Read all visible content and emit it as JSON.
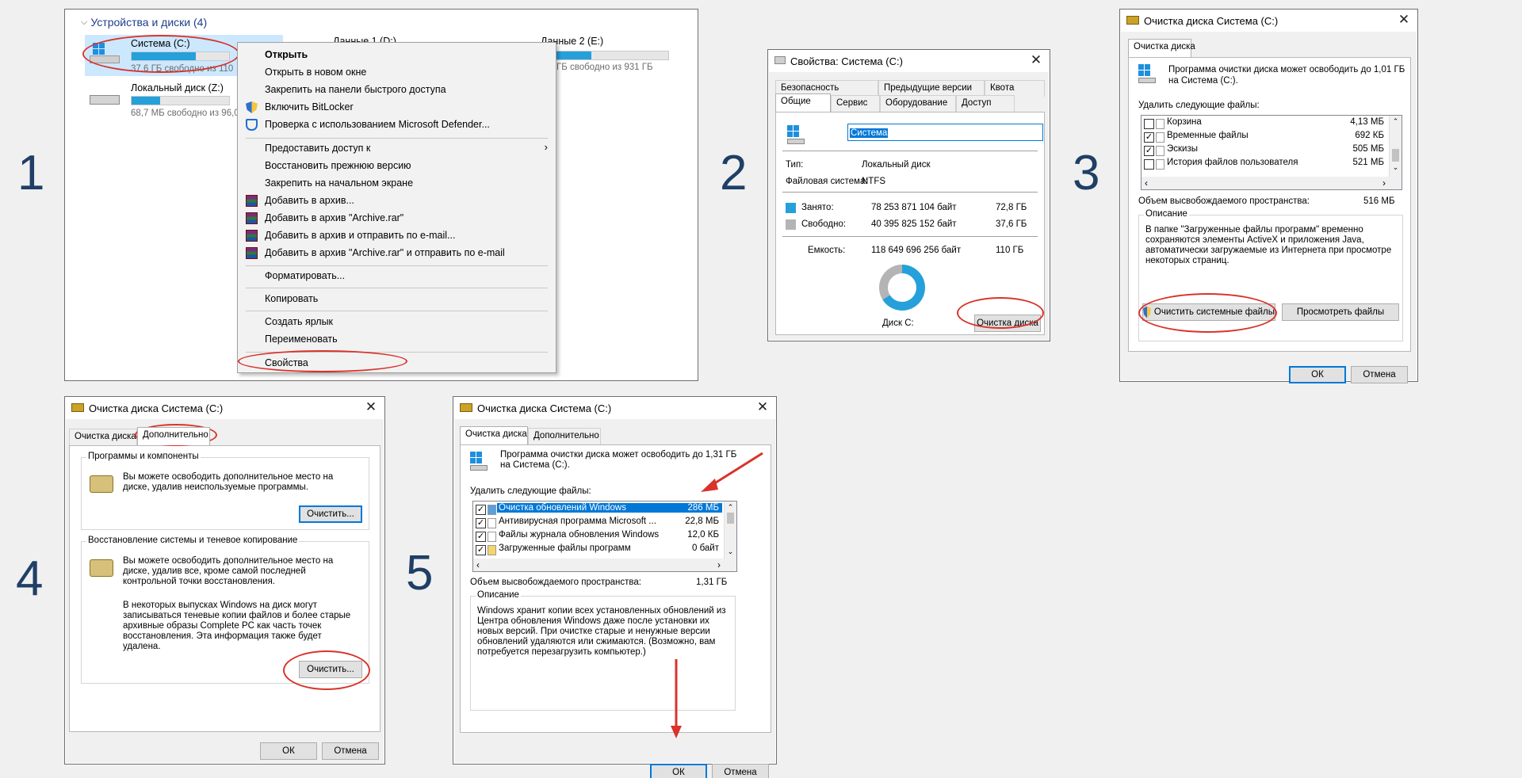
{
  "steps": [
    "1",
    "2",
    "3",
    "4",
    "5"
  ],
  "explorer": {
    "group_title": "Устройства и диски (4)",
    "drives": [
      {
        "name": "Система (C:)",
        "free": "37,6 ГБ свободно из 110",
        "fill": 0.66
      },
      {
        "name": "Локальный диск (Z:)",
        "free": "68,7 МБ свободно из 96,0",
        "fill": 0.29
      },
      {
        "name": "Данные 1 (D:)",
        "free": "",
        "fill": 0.5
      },
      {
        "name": "Данные 2 (E:)",
        "free": "ГБ свободно из 931 ГБ",
        "fill": 0.6
      }
    ],
    "drive_c_label_partial": "Данные 1 (D:)",
    "drive_e_label": "Данные 2 (E:)"
  },
  "context_menu": {
    "items": [
      {
        "label": "Открыть",
        "bold": true
      },
      {
        "label": "Открыть в новом окне"
      },
      {
        "label": "Закрепить на панели быстрого доступа"
      },
      {
        "label": "Включить BitLocker",
        "icon": "shield-icon"
      },
      {
        "label": "Проверка с использованием Microsoft Defender...",
        "icon": "defender-icon"
      },
      {
        "label": "Предоставить доступ к",
        "submenu": true
      },
      {
        "label": "Восстановить прежнюю версию"
      },
      {
        "label": "Закрепить на начальном экране"
      },
      {
        "label": "Добавить в архив...",
        "icon": "winrar-icon"
      },
      {
        "label": "Добавить в архив \"Archive.rar\"",
        "icon": "winrar-icon"
      },
      {
        "label": "Добавить в архив и отправить по e-mail...",
        "icon": "winrar-icon"
      },
      {
        "label": "Добавить в архив \"Archive.rar\" и отправить по e-mail",
        "icon": "winrar-icon"
      },
      {
        "label": "Форматировать..."
      },
      {
        "label": "Копировать"
      },
      {
        "label": "Создать ярлык"
      },
      {
        "label": "Переименовать"
      },
      {
        "label": "Свойства"
      }
    ]
  },
  "properties": {
    "title": "Свойства: Система (C:)",
    "tabs_row1": [
      "Безопасность",
      "Предыдущие версии",
      "Квота"
    ],
    "tabs_row2": [
      "Общие",
      "Сервис",
      "Оборудование",
      "Доступ"
    ],
    "name_value": "Система",
    "type_label": "Тип:",
    "type_value": "Локальный диск",
    "fs_label": "Файловая система:",
    "fs_value": "NTFS",
    "used_label": "Занято:",
    "used_bytes": "78 253 871 104 байт",
    "used_gb": "72,8 ГБ",
    "free_label": "Свободно:",
    "free_bytes": "40 395 825 152 байт",
    "free_gb": "37,6 ГБ",
    "cap_label": "Емкость:",
    "cap_bytes": "118 649 696 256 байт",
    "cap_gb": "110 ГБ",
    "disk_label": "Диск C:",
    "cleanup_button": "Очистка диска",
    "used_fraction": 0.66,
    "colors": {
      "used": "#26a0da",
      "free": "#b4b4b4"
    }
  },
  "cleanup3": {
    "title": "Очистка диска Система (C:)",
    "tab": "Очистка диска",
    "intro": "Программа очистки диска может освободить до 1,01 ГБ на Система (C:).",
    "delete_label": "Удалить следующие файлы:",
    "files": [
      {
        "name": "Корзина",
        "size": "4,13 МБ",
        "checked": false
      },
      {
        "name": "Временные файлы",
        "size": "692 КБ",
        "checked": true
      },
      {
        "name": "Эскизы",
        "size": "505 МБ",
        "checked": true
      },
      {
        "name": "История файлов пользователя",
        "size": "521 МБ",
        "checked": false
      }
    ],
    "total_label": "Объем высвобождаемого пространства:",
    "total_value": "516 МБ",
    "desc_title": "Описание",
    "desc_text": "В папке \"Загруженные файлы программ\" временно сохраняются элементы ActiveX и приложения Java, автоматически загружаемые из Интернета при просмотре некоторых страниц.",
    "sys_button": "Очистить системные файлы",
    "view_button": "Просмотреть файлы",
    "ok": "ОК",
    "cancel": "Отмена"
  },
  "cleanup4": {
    "title": "Очистка диска Система (C:)",
    "tabs": [
      "Очистка диска",
      "Дополнительно"
    ],
    "g1_title": "Программы и компоненты",
    "g1_text": "Вы можете освободить дополнительное место на диске, удалив неиспользуемые программы.",
    "g1_button": "Очистить...",
    "g2_title": "Восстановление системы и теневое копирование",
    "g2_text": "Вы можете освободить дополнительное место на диске, удалив все, кроме самой последней контрольной точки восстановления.",
    "g2_text2": "В некоторых выпусках Windows на диск могут записываться теневые копии файлов и более старые архивные образы Complete PC как часть точек восстановления. Эта информация также будет удалена.",
    "g2_button": "Очистить...",
    "ok": "ОК",
    "cancel": "Отмена"
  },
  "cleanup5": {
    "title": "Очистка диска Система (C:)",
    "tabs": [
      "Очистка диска",
      "Дополнительно"
    ],
    "intro": "Программа очистки диска может освободить до 1,31 ГБ на Система (C:).",
    "delete_label": "Удалить следующие файлы:",
    "files": [
      {
        "name": "Очистка обновлений Windows",
        "size": "286 МБ",
        "checked": true,
        "selected": true
      },
      {
        "name": "Антивирусная программа Microsoft ...",
        "size": "22,8 МБ",
        "checked": true
      },
      {
        "name": "Файлы журнала обновления Windows",
        "size": "12,0 КБ",
        "checked": true
      },
      {
        "name": "Загруженные файлы программ",
        "size": "0 байт",
        "checked": true
      }
    ],
    "total_label": "Объем высвобождаемого пространства:",
    "total_value": "1,31 ГБ",
    "desc_title": "Описание",
    "desc_text": "Windows хранит копии всех установленных обновлений из Центра обновления Windows даже после установки их новых версий. При очистке старые и ненужные версии обновлений удаляются или сжимаются. (Возможно, вам потребуется перезагрузить компьютер.)",
    "ok": "ОК",
    "cancel": "Отмена"
  }
}
